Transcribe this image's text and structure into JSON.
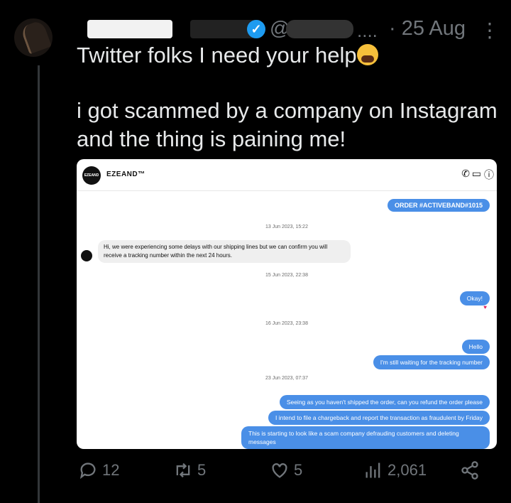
{
  "tweet": {
    "handle_prefix": "@",
    "ellipsis": "....",
    "date": "· 25 Aug",
    "text_line1": "Twitter folks I need your help",
    "text_line2": "i got scammed by a company on Instagram and the thing is paining me!"
  },
  "screenshot": {
    "logo_text": "EZEAND",
    "account_name": "EZEAND™",
    "order_label": "ORDER #ACTIVEBAND#1015",
    "timestamps": [
      "13 Jun 2023, 15:22",
      "15 Jun 2023, 22:38",
      "16 Jun 2023, 23:38",
      "23 Jun 2023, 07:37"
    ],
    "incoming_message": "Hi, we were experiencing some delays with our shipping lines but we can confirm you will receive a tracking number within the next 24 hours.",
    "outgoing": [
      "Okay!",
      "Hello",
      "I'm still waiting for the tracking number",
      "Seeing as you haven't shipped the order, can you refund the order please",
      "I intend to file a chargeback and report the transaction as fraudulent by Friday",
      "This is starting to look like a scam company defrauding customers and deleting messages"
    ]
  },
  "actions": {
    "replies": "12",
    "retweets": "5",
    "likes": "5",
    "views": "2,061"
  },
  "icons": [
    "verified-badge-icon",
    "more-icon",
    "reply-icon",
    "retweet-icon",
    "like-icon",
    "views-icon",
    "share-icon",
    "phone-icon",
    "video-icon",
    "info-icon",
    "heart-reaction-icon"
  ],
  "colors": {
    "background": "#000000",
    "muted": "#71767b",
    "verified": "#1d9bf0",
    "bubble_out": "#4a8fe7"
  }
}
